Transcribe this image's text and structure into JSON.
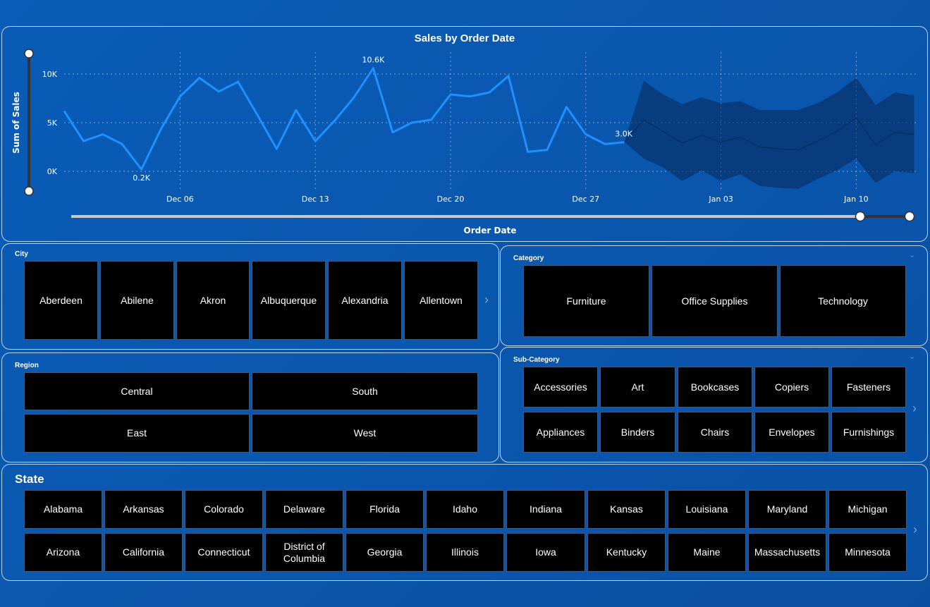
{
  "chart_panel": {
    "title": "Sales by Order Date",
    "y_axis_label": "Sum of Sales",
    "x_axis_label": "Order Date"
  },
  "chart_data": {
    "type": "line",
    "title": "Sales by Order Date",
    "xlabel": "Order Date",
    "ylabel": "Sum of Sales",
    "x_start": "Nov 30",
    "x_ticks": [
      {
        "label": "Dec 06",
        "day": 6
      },
      {
        "label": "Dec 13",
        "day": 13
      },
      {
        "label": "Dec 20",
        "day": 20
      },
      {
        "label": "Dec 27",
        "day": 27
      },
      {
        "label": "Jan 03",
        "day": 34
      },
      {
        "label": "Jan 10",
        "day": 41
      }
    ],
    "y_ticks": [
      {
        "label": "0K",
        "value": 0
      },
      {
        "label": "5K",
        "value": 5000
      },
      {
        "label": "10K",
        "value": 10000
      }
    ],
    "ylim": [
      0,
      12000
    ],
    "series": [
      {
        "name": "Sales",
        "color": "#1e90ff",
        "values": [
          6200,
          3100,
          3800,
          2800,
          200,
          4300,
          7700,
          9600,
          8200,
          9200,
          5800,
          2300,
          6300,
          3100,
          5200,
          7600,
          10600,
          4000,
          5000,
          5300,
          7900,
          7700,
          8100,
          9800,
          2000,
          2200,
          6600,
          3800,
          2800,
          3000
        ]
      },
      {
        "name": "Forecast",
        "color": "#0a2f66",
        "start_index": 29,
        "values": [
          3000,
          5300,
          4100,
          2900,
          3700,
          3000,
          3500,
          2500,
          2300,
          2200,
          3100,
          4100,
          5500,
          2700,
          4000,
          3800
        ],
        "upper": [
          3000,
          9300,
          7900,
          6900,
          7600,
          7000,
          7200,
          6300,
          6300,
          6300,
          7000,
          8100,
          9600,
          6800,
          8100,
          7800
        ],
        "lower": [
          3000,
          1300,
          400,
          -1000,
          100,
          -1000,
          -300,
          -1500,
          -1700,
          -1800,
          -800,
          100,
          1300,
          -1200,
          0,
          -200
        ]
      }
    ],
    "annotations": [
      {
        "label": "0.2K",
        "index": 4
      },
      {
        "label": "10.6K",
        "index": 16
      },
      {
        "label": "3.0K",
        "index": 29
      }
    ]
  },
  "city": {
    "title": "City",
    "items": [
      "Aberdeen",
      "Abilene",
      "Akron",
      "Albuquerque",
      "Alexandria",
      "Allentown"
    ]
  },
  "category": {
    "title": "Category",
    "items": [
      "Furniture",
      "Office Supplies",
      "Technology"
    ]
  },
  "region": {
    "title": "Region",
    "items": [
      "Central",
      "South",
      "East",
      "West"
    ]
  },
  "subcategory": {
    "title": "Sub-Category",
    "items": [
      "Accessories",
      "Art",
      "Bookcases",
      "Copiers",
      "Fasteners",
      "Appliances",
      "Binders",
      "Chairs",
      "Envelopes",
      "Furnishings"
    ]
  },
  "state": {
    "title": "State",
    "items": [
      "Alabama",
      "Arkansas",
      "Colorado",
      "Delaware",
      "Florida",
      "Idaho",
      "Indiana",
      "Kansas",
      "Louisiana",
      "Maryland",
      "Michigan",
      "Arizona",
      "California",
      "Connecticut",
      "District of Columbia",
      "Georgia",
      "Illinois",
      "Iowa",
      "Kentucky",
      "Maine",
      "Massachusetts",
      "Minnesota"
    ]
  },
  "icons": {
    "next": "chevron-right-icon",
    "collapse": "chevron-down-icon"
  }
}
